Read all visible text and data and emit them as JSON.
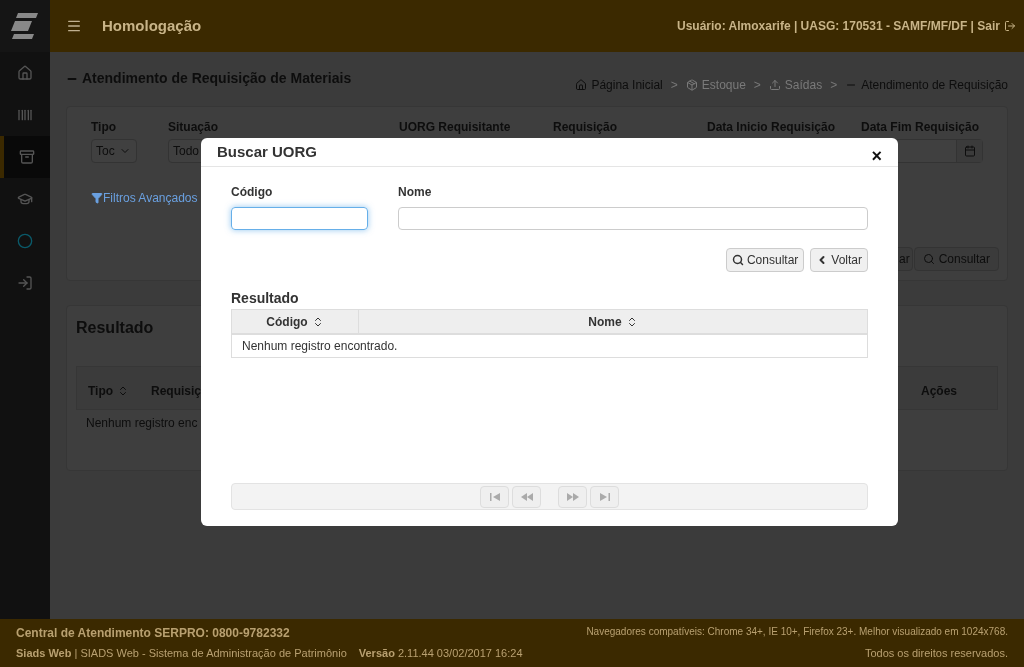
{
  "header": {
    "title": "Homologação",
    "user_info": "Usuário: Almoxarife | UASG: 170531 - SAMF/MF/DF | Sair"
  },
  "sidebar": {
    "items": [
      {
        "kind": "home",
        "selected": false
      },
      {
        "kind": "barcode",
        "selected": false
      },
      {
        "kind": "archive",
        "selected": true
      },
      {
        "kind": "cap",
        "selected": false
      },
      {
        "kind": "circle",
        "selected": false
      },
      {
        "kind": "login",
        "selected": false
      }
    ]
  },
  "page": {
    "title": "Atendimento de Requisição de Materiais",
    "breadcrumb": [
      {
        "kind": "home",
        "label": "Página Inicial",
        "disabled": false
      },
      {
        "kind": "box",
        "separator": ">",
        "label": "Estoque",
        "disabled": true
      },
      {
        "kind": "upload",
        "separator": ">",
        "label": "Saídas",
        "disabled": true
      },
      {
        "kind": "minus",
        "separator": ">",
        "label": "Atendimento de Requisição",
        "disabled": false
      }
    ]
  },
  "filters": {
    "labels": [
      "Tipo",
      "Situação",
      "UORG Requisitante",
      "Requisição",
      "Data Inicio Requisição",
      "Data Fim Requisição"
    ],
    "tipo_value": "Toc",
    "situacao_value": "Todo",
    "advanced_link": "Filtros Avançados",
    "buttons": [
      "ar",
      "Consultar"
    ]
  },
  "results": {
    "title": "Resultado",
    "columns": [
      "Tipo",
      "Requisiç",
      "Ações"
    ],
    "empty_message": "Nenhum registro enc"
  },
  "modal": {
    "title": "Buscar UORG",
    "close": "×",
    "fields": [
      {
        "label": "Código",
        "focused": true
      },
      {
        "label": "Nome",
        "focused": false
      }
    ],
    "buttons": [
      {
        "kind": "search",
        "label": "Consultar"
      },
      {
        "kind": "back",
        "label": "Voltar"
      }
    ],
    "result_title": "Resultado",
    "columns": [
      "Código",
      "Nome"
    ],
    "empty_message": "Nenhum registro encontrado.",
    "pagination": [
      {
        "kind": "first",
        "disabled": true
      },
      {
        "kind": "prev",
        "disabled": true
      },
      {
        "kind": "next",
        "disabled": true
      },
      {
        "kind": "last",
        "disabled": true
      }
    ]
  },
  "footer": {
    "support": "Central de Atendimento SERPRO: 0800-9782332",
    "browsers": "Navegadores compatíveis: Chrome 34+, IE 10+, Firefox 23+. Melhor visualizado em 1024x768.",
    "system": "**Siads Web** | SIADS Web - Sistema de Administração de Patrimônio",
    "version": "**Versão** 2.11.44 03/02/2017 16:24",
    "rights": "Todos os direitos reservados."
  }
}
